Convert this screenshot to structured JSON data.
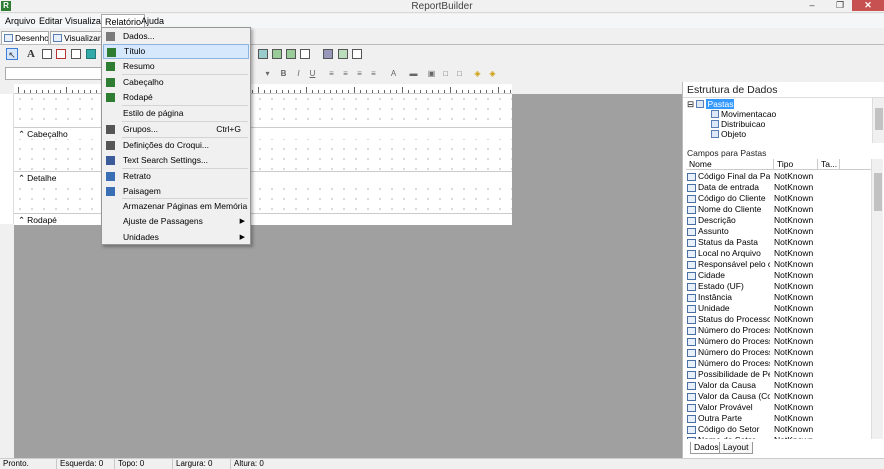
{
  "window": {
    "title": "ReportBuilder",
    "app_icon": "R",
    "min_glyph": "–",
    "max_glyph": "❐",
    "close_glyph": "✕"
  },
  "menu": [
    "Arquivo",
    "Editar",
    "Visualizar",
    "Relatório",
    "Ajuda"
  ],
  "tabs": [
    "Desenho",
    "Visualizar Im"
  ],
  "dropdown": [
    {
      "label": "Dados...",
      "icon": "dados-icon"
    },
    {
      "label": "Título",
      "icon": "titulo-icon",
      "highlighted": true
    },
    {
      "label": "Resumo",
      "icon": "resumo-icon"
    },
    {
      "label": "Cabeçalho",
      "icon": "cabecalho-icon"
    },
    {
      "label": "Rodapé",
      "icon": "rodape-icon"
    },
    {
      "label": "Estilo de página",
      "icon": ""
    },
    {
      "label": "Grupos...",
      "icon": "grupos-icon",
      "shortcut": "Ctrl+G"
    },
    {
      "label": "Definições do Croqui...",
      "icon": "croqui-icon"
    },
    {
      "label": "Text Search Settings...",
      "icon": "binoculars-icon"
    },
    {
      "label": "Retrato",
      "icon": "retrato-icon"
    },
    {
      "label": "Paisagem",
      "icon": "paisagem-icon"
    },
    {
      "label": "Armazenar Páginas em Memória",
      "icon": ""
    },
    {
      "label": "Ajuste de Passagens",
      "icon": "",
      "submenu": true
    },
    {
      "label": "Unidades",
      "icon": "",
      "submenu": true
    }
  ],
  "bands": [
    "Cabeçalho",
    "Detalhe",
    "Rodapé"
  ],
  "right_panel": {
    "title": "Estrutura de Dados",
    "tree": [
      "Pastas",
      "Movimentacao",
      "Distribuicao",
      "Objeto"
    ],
    "campos_label": "Campos para Pastas",
    "columns": [
      "Nome",
      "Tipo",
      "Ta..."
    ],
    "fields": [
      [
        "Código Final da Pasta",
        "NotKnown"
      ],
      [
        "Data de entrada",
        "NotKnown"
      ],
      [
        "Código do Cliente",
        "NotKnown"
      ],
      [
        "Nome do Cliente",
        "NotKnown"
      ],
      [
        "Descrição",
        "NotKnown"
      ],
      [
        "Assunto",
        "NotKnown"
      ],
      [
        "Status da Pasta",
        "NotKnown"
      ],
      [
        "Local no Arquivo",
        "NotKnown"
      ],
      [
        "Responsável pelo c...",
        "NotKnown"
      ],
      [
        "Cidade",
        "NotKnown"
      ],
      [
        "Estado (UF)",
        "NotKnown"
      ],
      [
        "Instância",
        "NotKnown"
      ],
      [
        "Unidade",
        "NotKnown"
      ],
      [
        "Status do Processo",
        "NotKnown"
      ],
      [
        "Número do Processo...",
        "NotKnown"
      ],
      [
        "Número do Processo...",
        "NotKnown"
      ],
      [
        "Número do Processo...",
        "NotKnown"
      ],
      [
        "Número do Processo...",
        "NotKnown"
      ],
      [
        "Possibilidade de Perda",
        "NotKnown"
      ],
      [
        "Valor da Causa",
        "NotKnown"
      ],
      [
        "Valor da Causa (Corri...",
        "NotKnown"
      ],
      [
        "Valor Provável",
        "NotKnown"
      ],
      [
        "Outra Parte",
        "NotKnown"
      ],
      [
        "Código do Setor",
        "NotKnown"
      ],
      [
        "Nome do Setor",
        "NotKnown"
      ]
    ],
    "tabs": [
      "Dados",
      "Layout"
    ]
  },
  "status": {
    "text": "Pronto.",
    "esquerda": "Esquerda: 0",
    "topo": "Topo: 0",
    "largura": "Largura: 0",
    "altura": "Altura: 0"
  }
}
